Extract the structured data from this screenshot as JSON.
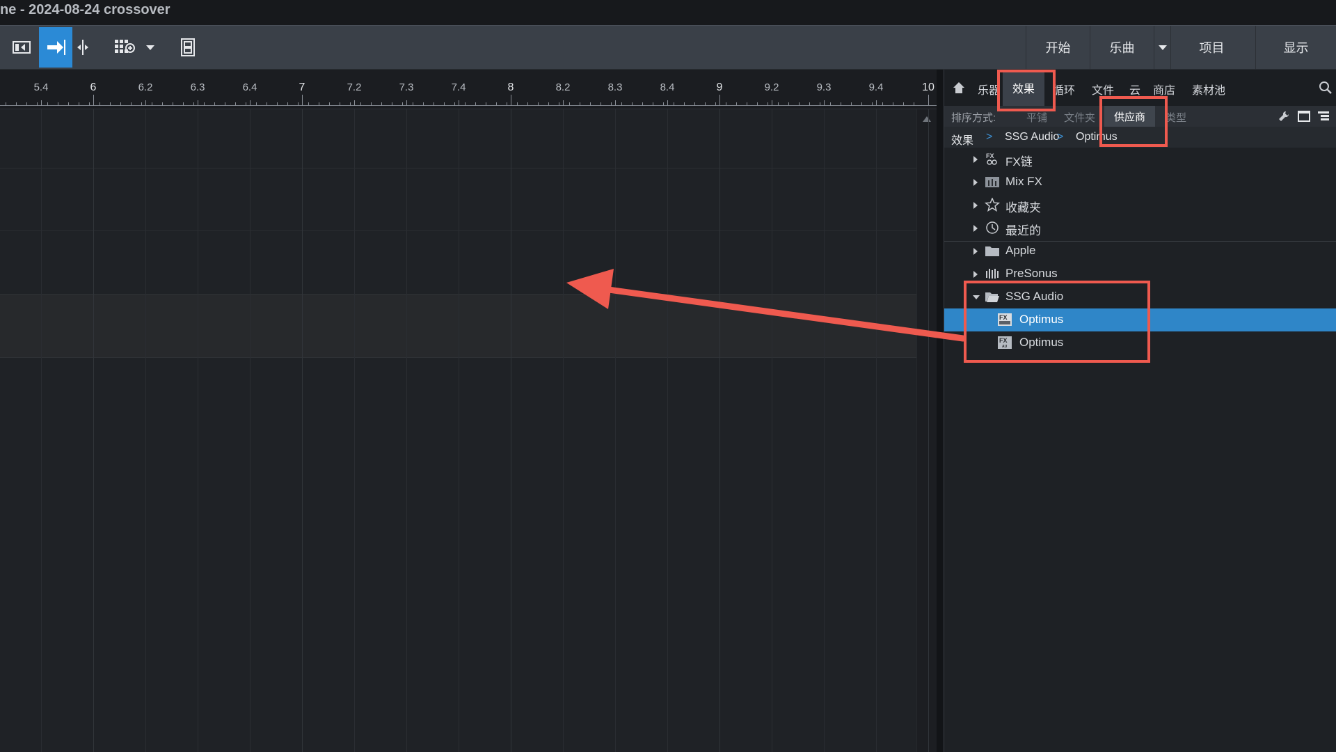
{
  "window": {
    "title": "ne - 2024-08-24 crossover"
  },
  "toolbar": {
    "right_buttons": [
      "开始",
      "乐曲",
      "项目",
      "显示"
    ]
  },
  "ruler": {
    "labels": [
      {
        "text": "5.4",
        "major": false
      },
      {
        "text": "6",
        "major": true
      },
      {
        "text": "6.2",
        "major": false
      },
      {
        "text": "6.3",
        "major": false
      },
      {
        "text": "6.4",
        "major": false
      },
      {
        "text": "7",
        "major": true
      },
      {
        "text": "7.2",
        "major": false
      },
      {
        "text": "7.3",
        "major": false
      },
      {
        "text": "7.4",
        "major": false
      },
      {
        "text": "8",
        "major": true
      },
      {
        "text": "8.2",
        "major": false
      },
      {
        "text": "8.3",
        "major": false
      },
      {
        "text": "8.4",
        "major": false
      },
      {
        "text": "9",
        "major": true
      },
      {
        "text": "9.2",
        "major": false
      },
      {
        "text": "9.3",
        "major": false
      },
      {
        "text": "9.4",
        "major": false
      },
      {
        "text": "10",
        "major": true
      }
    ]
  },
  "browser": {
    "tabs": [
      "乐器",
      "效果",
      "循环",
      "文件",
      "云",
      "商店",
      "素材池"
    ],
    "active_tab": "效果",
    "sort": {
      "label": "排序方式:",
      "options": [
        "平铺",
        "文件夹",
        "供应商",
        "类型"
      ],
      "active": "供应商"
    },
    "breadcrumb": [
      "效果",
      "SSG Audio",
      "Optimus"
    ],
    "items": [
      {
        "label": "FX链",
        "icon": "fx-chain-icon"
      },
      {
        "label": "Mix FX",
        "icon": "mix-fx-icon"
      },
      {
        "label": "收藏夹",
        "icon": "star-icon"
      },
      {
        "label": "最近的",
        "icon": "clock-icon"
      },
      {
        "label": "Apple",
        "icon": "folder-icon"
      },
      {
        "label": "PreSonus",
        "icon": "presonus-icon"
      },
      {
        "label": "SSG Audio",
        "icon": "folder-open-icon"
      },
      {
        "label": "Optimus",
        "icon": "fx-plugin-icon",
        "badge": "FX"
      },
      {
        "label": "Optimus",
        "icon": "fx-plugin-au-icon",
        "badge": "FX",
        "sub_badge": "AU"
      }
    ]
  },
  "colors": {
    "accent": "#2f86c8",
    "annotation": "#ef5a4f"
  }
}
